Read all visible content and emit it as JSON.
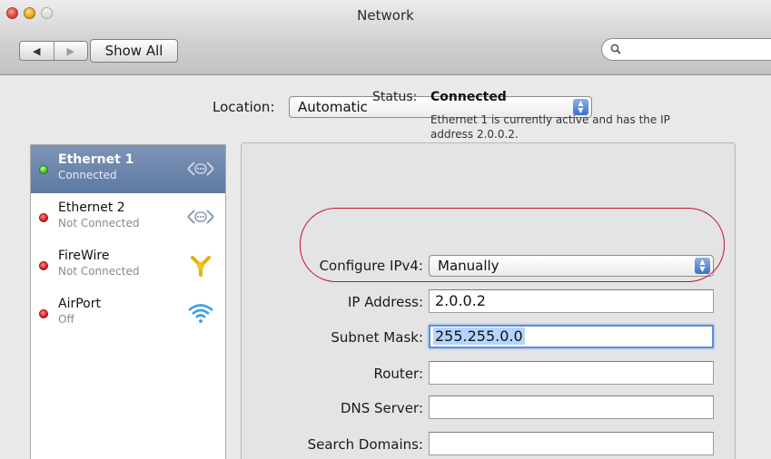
{
  "window": {
    "title": "Network"
  },
  "toolbar": {
    "back_glyph": "◀",
    "forward_glyph": "▶",
    "show_all_label": "Show All",
    "search_placeholder": ""
  },
  "location": {
    "label": "Location:",
    "value": "Automatic"
  },
  "sidebar": {
    "items": [
      {
        "name": "Ethernet 1",
        "status": "Connected",
        "dot": "green",
        "icon": "ethernet-icon",
        "selected": true
      },
      {
        "name": "Ethernet 2",
        "status": "Not Connected",
        "dot": "red",
        "icon": "ethernet-icon",
        "selected": false
      },
      {
        "name": "FireWire",
        "status": "Not Connected",
        "dot": "red",
        "icon": "firewire-icon",
        "selected": false
      },
      {
        "name": "AirPort",
        "status": "Off",
        "dot": "red",
        "icon": "wifi-icon",
        "selected": false
      }
    ]
  },
  "detail": {
    "status_label": "Status:",
    "status_value": "Connected",
    "status_description": "Ethernet 1 is currently active and has the IP address 2.0.0.2.",
    "configure_label": "Configure IPv4:",
    "configure_value": "Manually",
    "ip_label": "IP Address:",
    "ip_value": "2.0.0.2",
    "subnet_label": "Subnet Mask:",
    "subnet_value": "255.255.0.0",
    "router_label": "Router:",
    "router_value": "",
    "dns_label": "DNS Server:",
    "dns_value": "",
    "search_domains_label": "Search Domains:",
    "search_domains_value": ""
  },
  "colors": {
    "selection": "#6b85ad",
    "annotation": "#c8102e",
    "focus_ring": "#5d8fd6"
  }
}
